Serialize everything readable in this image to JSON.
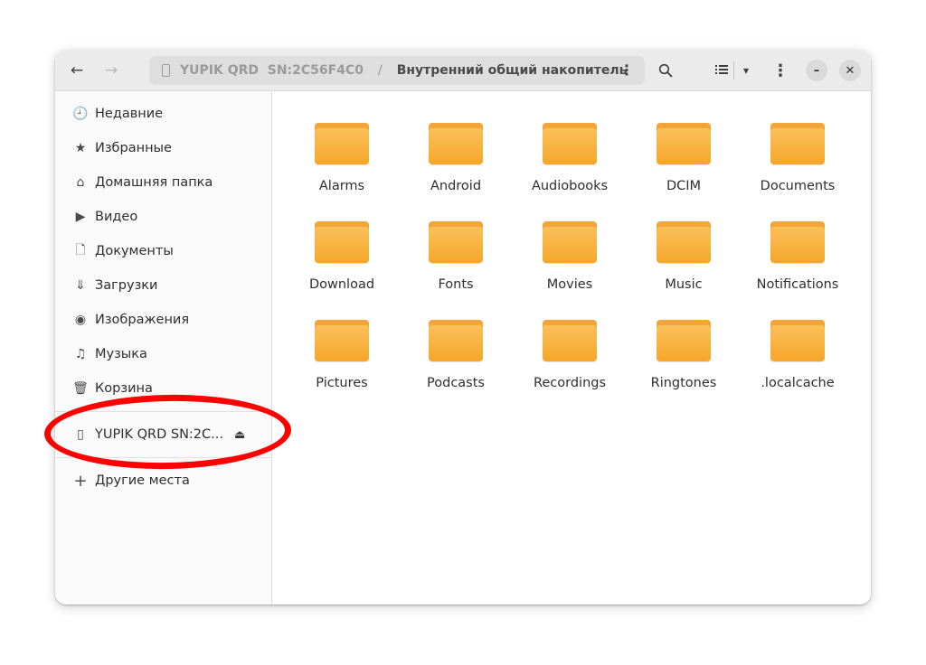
{
  "header": {
    "back_icon": "←",
    "forward_icon": "→",
    "path": {
      "device_label": "YUPIK QRD  SN:2C56F4C0",
      "separator": "/",
      "current": "Внутренний общий накопитель",
      "menu_icon": "⋮"
    },
    "search_icon": "🔍",
    "view_list_icon": "☰",
    "view_caret_icon": "▾",
    "main_menu_icon": "⋮",
    "minimize_icon": "–",
    "close_icon": "✕"
  },
  "sidebar": {
    "items": [
      {
        "label": "Недавние",
        "icon": "🕘"
      },
      {
        "label": "Избранные",
        "icon": "★"
      },
      {
        "label": "Домашняя папка",
        "icon": "⌂"
      },
      {
        "label": "Видео",
        "icon": "▶"
      },
      {
        "label": "Документы",
        "icon": "🗋"
      },
      {
        "label": "Загрузки",
        "icon": "⇓"
      },
      {
        "label": "Изображения",
        "icon": "◉"
      },
      {
        "label": "Музыка",
        "icon": "♫"
      },
      {
        "label": "Корзина",
        "icon": "🗑"
      }
    ],
    "device": {
      "label": "YUPIK QRD  SN:2C...",
      "icon": "▯",
      "eject_icon": "⏏"
    },
    "other": {
      "label": "Другие места",
      "icon": "+"
    }
  },
  "folders": [
    {
      "name": "Alarms"
    },
    {
      "name": "Android"
    },
    {
      "name": "Audiobooks"
    },
    {
      "name": "DCIM"
    },
    {
      "name": "Documents"
    },
    {
      "name": "Download"
    },
    {
      "name": "Fonts"
    },
    {
      "name": "Movies"
    },
    {
      "name": "Music"
    },
    {
      "name": "Notifications"
    },
    {
      "name": "Pictures"
    },
    {
      "name": "Podcasts"
    },
    {
      "name": "Recordings"
    },
    {
      "name": "Ringtones"
    },
    {
      "name": ".localcache"
    }
  ],
  "colors": {
    "folder": "#f5a62a",
    "annotation": "#ff0000",
    "header_bg": "#ebebeb"
  }
}
